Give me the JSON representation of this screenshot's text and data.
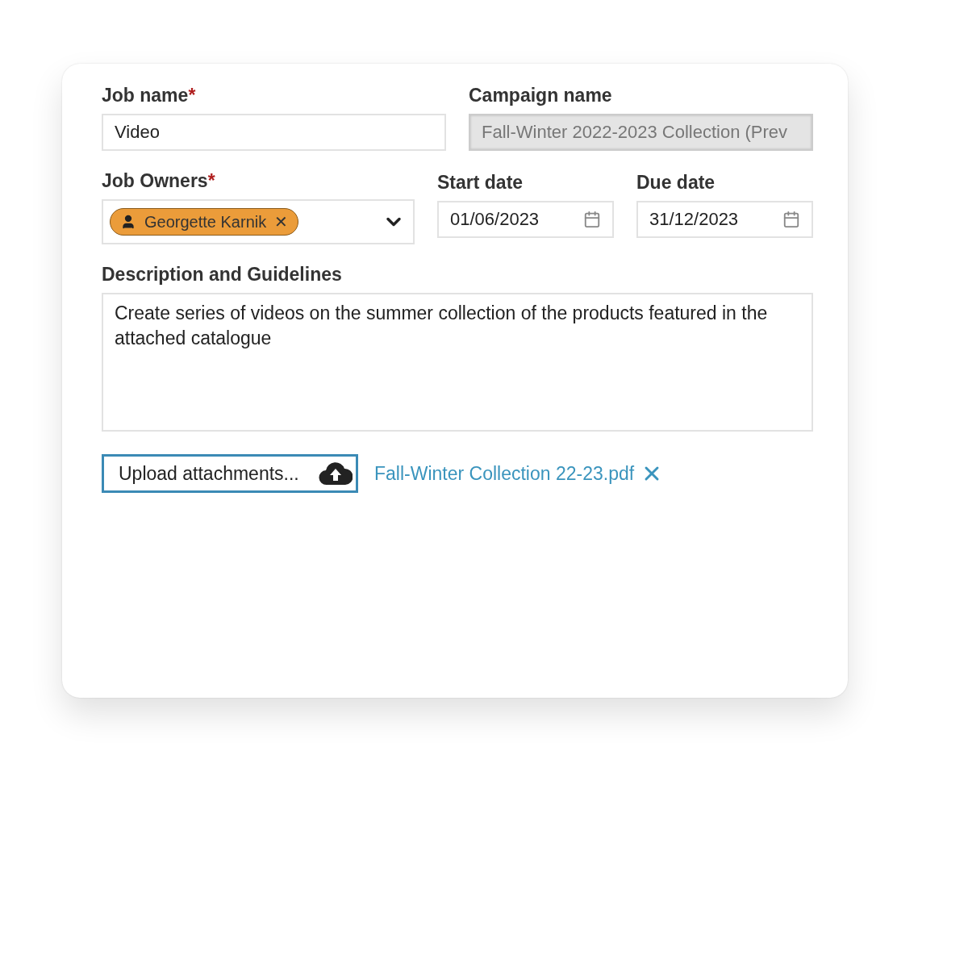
{
  "job_name": {
    "label": "Job name",
    "required_mark": "*",
    "value": "Video"
  },
  "campaign_name": {
    "label": "Campaign name",
    "disabled": true,
    "value": "Fall-Winter 2022-2023 Collection (Prev"
  },
  "job_owners": {
    "label": "Job Owners",
    "required_mark": "*",
    "chips": [
      {
        "label": "Georgette Karnik",
        "remove": "✕"
      }
    ]
  },
  "start_date": {
    "label": "Start date",
    "value": "01/06/2023"
  },
  "due_date": {
    "label": "Due date",
    "value": "31/12/2023"
  },
  "description": {
    "label": "Description and Guidelines",
    "value": "Create series of videos on the summer collection of the products featured in the attached catalogue"
  },
  "upload": {
    "label": "Upload attachments..."
  },
  "attachments": [
    {
      "name": "Fall-Winter Collection 22-23.pdf"
    }
  ]
}
